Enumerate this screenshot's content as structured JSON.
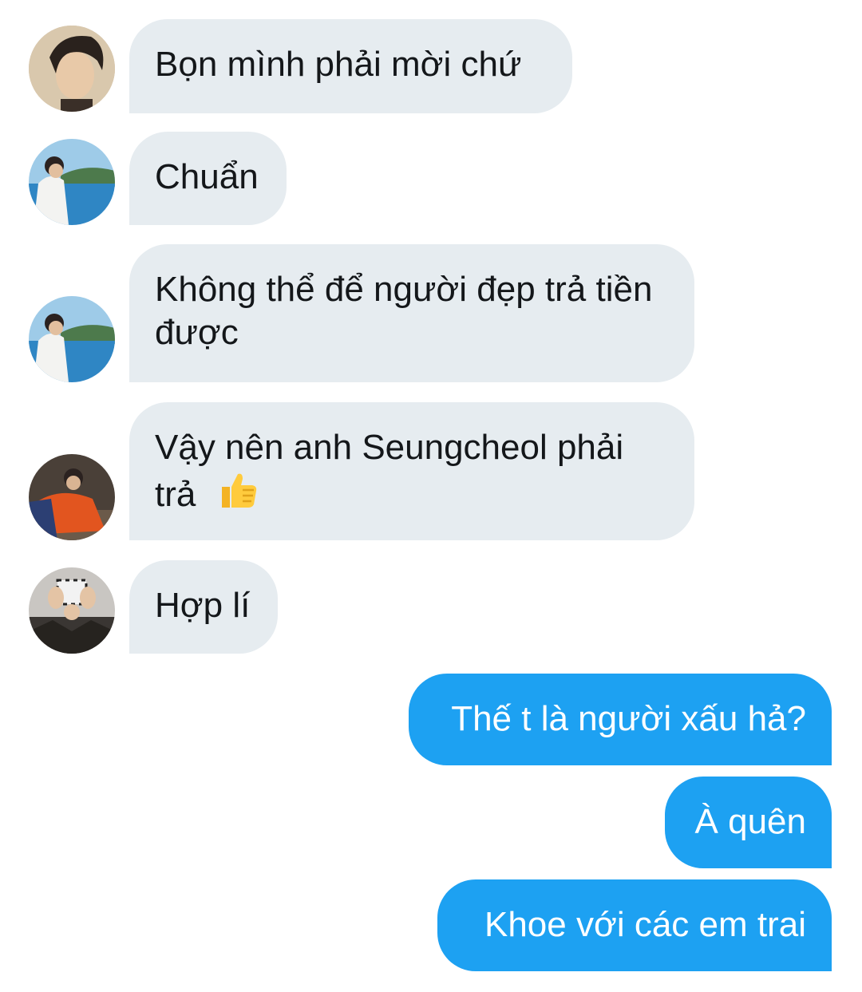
{
  "conversation": {
    "messages": [
      {
        "sender": "contact-1",
        "direction": "incoming",
        "text": "Bọn mình phải mời chứ"
      },
      {
        "sender": "contact-2",
        "direction": "incoming",
        "text": "Chuẩn"
      },
      {
        "sender": "contact-2",
        "direction": "incoming",
        "text": "Không thể để người đẹp trả tiền được"
      },
      {
        "sender": "contact-3",
        "direction": "incoming",
        "text": "Vậy nên anh Seungcheol phải trả",
        "emoji": "thumbs-up-icon"
      },
      {
        "sender": "contact-4",
        "direction": "incoming",
        "text": "Hợp lí"
      },
      {
        "sender": "me",
        "direction": "outgoing",
        "text": "Thế t là người xấu hả?"
      },
      {
        "sender": "me",
        "direction": "outgoing",
        "text": "À quên"
      },
      {
        "sender": "me",
        "direction": "outgoing",
        "text": "Khoe với các em trai"
      }
    ]
  },
  "colors": {
    "incoming_bubble": "#e6ecf0",
    "outgoing_bubble": "#1da1f2",
    "incoming_text": "#14171a",
    "outgoing_text": "#ffffff"
  }
}
